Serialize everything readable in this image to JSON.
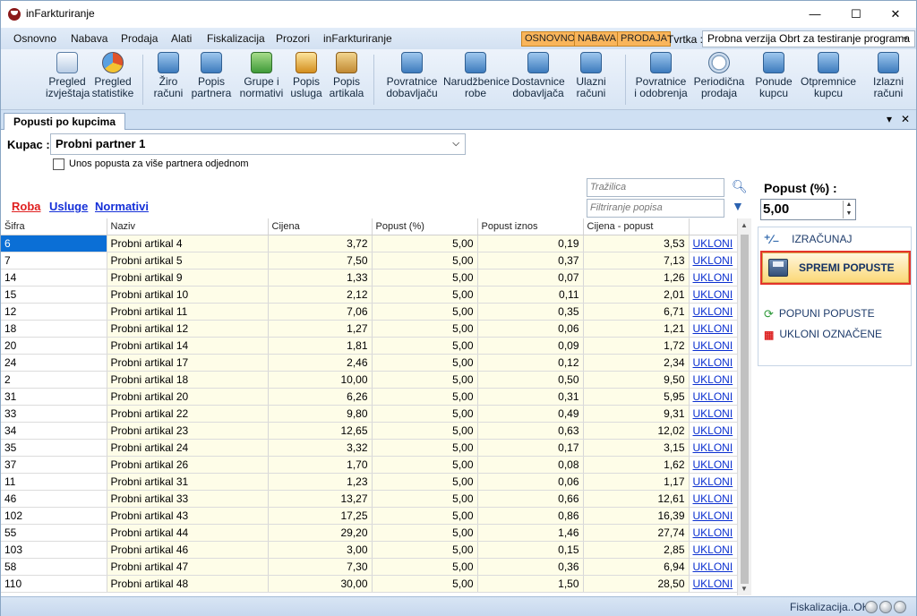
{
  "window": {
    "title": "inFarkturiranje",
    "minimize": "—",
    "maximize": "☐",
    "close": "✕"
  },
  "menu": [
    "Osnovno",
    "Nabava",
    "Prodaja",
    "Alati",
    "Fiskalizacija",
    "Prozori",
    "inFarkturiranje"
  ],
  "mode_tags": [
    "OSNOVNO",
    "NABAVA",
    "PRODAJA"
  ],
  "company": {
    "label": "Tvrtka :",
    "value": "Probna verzija Obrt za testiranje programa"
  },
  "toolbar": [
    {
      "l1": "Pregled",
      "l2": "izvještaja",
      "icon": "report-icon"
    },
    {
      "l1": "Pregled",
      "l2": "statistike",
      "icon": "pie-chart-icon"
    },
    {
      "l1": "Žiro",
      "l2": "računi",
      "icon": "bank-account-icon"
    },
    {
      "l1": "Popis",
      "l2": "partnera",
      "icon": "partners-icon"
    },
    {
      "l1": "Grupe i",
      "l2": "normativi",
      "icon": "groups-icon"
    },
    {
      "l1": "Popis",
      "l2": "usluga",
      "icon": "services-icon"
    },
    {
      "l1": "Popis",
      "l2": "artikala",
      "icon": "articles-box-icon"
    },
    {
      "l1": "Povratnice",
      "l2": "dobavljaču",
      "icon": "return-supplier-icon"
    },
    {
      "l1": "Narudžbenice",
      "l2": "robe",
      "icon": "purchase-order-icon"
    },
    {
      "l1": "Dostavnice",
      "l2": "dobavljača",
      "icon": "delivery-note-icon"
    },
    {
      "l1": "Ulazni",
      "l2": "računi",
      "icon": "incoming-invoice-icon"
    },
    {
      "l1": "Povratnice",
      "l2": "i odobrenja",
      "icon": "returns-approvals-icon"
    },
    {
      "l1": "Periodična",
      "l2": "prodaja",
      "icon": "clock-icon"
    },
    {
      "l1": "Ponude",
      "l2": "kupcu",
      "icon": "offer-icon"
    },
    {
      "l1": "Otpremnice",
      "l2": "kupcu",
      "icon": "dispatch-note-icon"
    },
    {
      "l1": "Izlazni",
      "l2": "računi",
      "icon": "outgoing-invoice-icon"
    }
  ],
  "tab": {
    "label": "Popusti po kupcima",
    "pin": "▾",
    "close": "✕"
  },
  "kupac": {
    "label": "Kupac :",
    "value": "Probni partner 1",
    "checkbox_label": "Unos popusta za više partnera odjednom"
  },
  "filters": {
    "roba": "Roba",
    "usluge": "Usluge",
    "normativi": "Normativi",
    "search_placeholder": "Tražilica",
    "filter_placeholder": "Filtriranje popisa"
  },
  "columns": [
    "Šifra",
    "Naziv",
    "Cijena",
    "Popust (%)",
    "Popust iznos",
    "Cijena - popust",
    ""
  ],
  "rows": [
    [
      "6",
      "Probni artikal 4",
      "3,72",
      "5,00",
      "0,19",
      "3,53",
      "UKLONI"
    ],
    [
      "7",
      "Probni artikal 5",
      "7,50",
      "5,00",
      "0,37",
      "7,13",
      "UKLONI"
    ],
    [
      "14",
      "Probni artikal 9",
      "1,33",
      "5,00",
      "0,07",
      "1,26",
      "UKLONI"
    ],
    [
      "15",
      "Probni artikal 10",
      "2,12",
      "5,00",
      "0,11",
      "2,01",
      "UKLONI"
    ],
    [
      "12",
      "Probni artikal 11",
      "7,06",
      "5,00",
      "0,35",
      "6,71",
      "UKLONI"
    ],
    [
      "18",
      "Probni artikal 12",
      "1,27",
      "5,00",
      "0,06",
      "1,21",
      "UKLONI"
    ],
    [
      "20",
      "Probni artikal 14",
      "1,81",
      "5,00",
      "0,09",
      "1,72",
      "UKLONI"
    ],
    [
      "24",
      "Probni artikal 17",
      "2,46",
      "5,00",
      "0,12",
      "2,34",
      "UKLONI"
    ],
    [
      "2",
      "Probni artikal 18",
      "10,00",
      "5,00",
      "0,50",
      "9,50",
      "UKLONI"
    ],
    [
      "31",
      "Probni artikal 20",
      "6,26",
      "5,00",
      "0,31",
      "5,95",
      "UKLONI"
    ],
    [
      "33",
      "Probni artikal 22",
      "9,80",
      "5,00",
      "0,49",
      "9,31",
      "UKLONI"
    ],
    [
      "34",
      "Probni artikal 23",
      "12,65",
      "5,00",
      "0,63",
      "12,02",
      "UKLONI"
    ],
    [
      "35",
      "Probni artikal 24",
      "3,32",
      "5,00",
      "0,17",
      "3,15",
      "UKLONI"
    ],
    [
      "37",
      "Probni artikal 26",
      "1,70",
      "5,00",
      "0,08",
      "1,62",
      "UKLONI"
    ],
    [
      "11",
      "Probni artikal 31",
      "1,23",
      "5,00",
      "0,06",
      "1,17",
      "UKLONI"
    ],
    [
      "46",
      "Probni artikal 33",
      "13,27",
      "5,00",
      "0,66",
      "12,61",
      "UKLONI"
    ],
    [
      "102",
      "Probni artikal 43",
      "17,25",
      "5,00",
      "0,86",
      "16,39",
      "UKLONI"
    ],
    [
      "55",
      "Probni artikal 44",
      "29,20",
      "5,00",
      "1,46",
      "27,74",
      "UKLONI"
    ],
    [
      "103",
      "Probni artikal 46",
      "3,00",
      "5,00",
      "0,15",
      "2,85",
      "UKLONI"
    ],
    [
      "58",
      "Probni artikal 47",
      "7,30",
      "5,00",
      "0,36",
      "6,94",
      "UKLONI"
    ],
    [
      "110",
      "Probni artikal 48",
      "30,00",
      "5,00",
      "1,50",
      "28,50",
      "UKLONI"
    ]
  ],
  "right_panel": {
    "popust_label": "Popust (%) :",
    "popust_value": "5,00",
    "izracunaj": "IZRAČUNAJ",
    "spremi": "SPREMI POPUSTE",
    "popuni": "POPUNI POPUSTE",
    "ukloni_oznacene": "UKLONI OZNAČENE"
  },
  "status": {
    "text": "Fiskalizacija..OK"
  },
  "colors": {
    "accent_tag": "#f9b55b",
    "selected_row": "#0b6fd6",
    "link": "#0a2fd0",
    "roba_link": "#e02020",
    "save_highlight": "#e4342b"
  }
}
